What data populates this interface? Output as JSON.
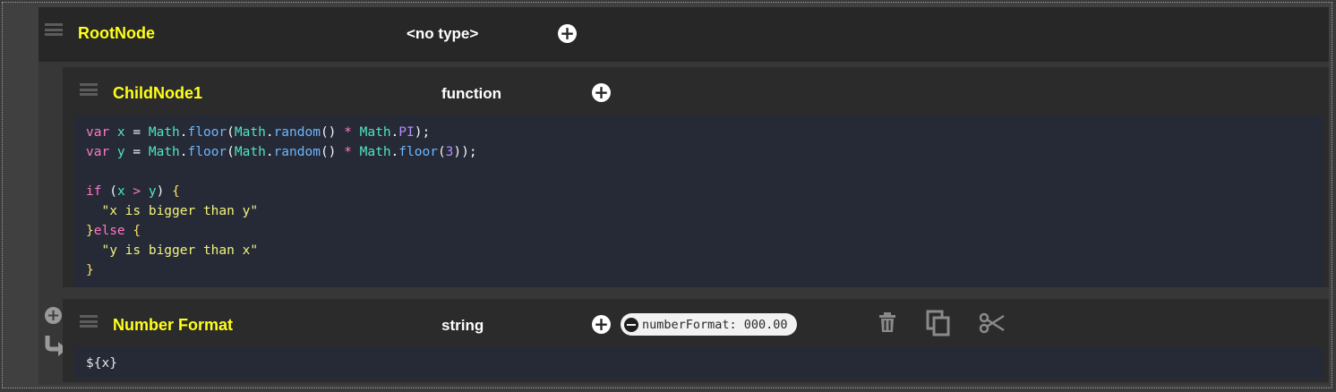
{
  "root": {
    "name": "RootNode",
    "type": "<no type>"
  },
  "child": {
    "name": "ChildNode1",
    "type": "function",
    "code_lines": [
      [
        [
          "kw",
          "var "
        ],
        [
          "var",
          "x"
        ],
        [
          "pl",
          " = "
        ],
        [
          "var",
          "Math"
        ],
        [
          "pl",
          "."
        ],
        [
          "fn",
          "floor"
        ],
        [
          "pl",
          "("
        ],
        [
          "var",
          "Math"
        ],
        [
          "pl",
          "."
        ],
        [
          "fn",
          "random"
        ],
        [
          "pl",
          "() "
        ],
        [
          "op",
          "*"
        ],
        [
          "pl",
          " "
        ],
        [
          "var",
          "Math"
        ],
        [
          "pl",
          "."
        ],
        [
          "num",
          "PI"
        ],
        [
          "pl",
          ");"
        ]
      ],
      [
        [
          "kw",
          "var "
        ],
        [
          "var",
          "y"
        ],
        [
          "pl",
          " = "
        ],
        [
          "var",
          "Math"
        ],
        [
          "pl",
          "."
        ],
        [
          "fn",
          "floor"
        ],
        [
          "pl",
          "("
        ],
        [
          "var",
          "Math"
        ],
        [
          "pl",
          "."
        ],
        [
          "fn",
          "random"
        ],
        [
          "pl",
          "() "
        ],
        [
          "op",
          "*"
        ],
        [
          "pl",
          " "
        ],
        [
          "var",
          "Math"
        ],
        [
          "pl",
          "."
        ],
        [
          "fn",
          "floor"
        ],
        [
          "pl",
          "("
        ],
        [
          "num",
          "3"
        ],
        [
          "pl",
          "));"
        ]
      ],
      [],
      [
        [
          "kw",
          "if "
        ],
        [
          "pl",
          "("
        ],
        [
          "var",
          "x"
        ],
        [
          "op",
          " > "
        ],
        [
          "var",
          "y"
        ],
        [
          "pl",
          ") "
        ],
        [
          "br",
          "{"
        ]
      ],
      [
        [
          "str",
          "  \"x is bigger than y\""
        ]
      ],
      [
        [
          "br",
          "}"
        ],
        [
          "kw",
          "else "
        ],
        [
          "br",
          "{"
        ]
      ],
      [
        [
          "str",
          "  \"y is bigger than x\""
        ]
      ],
      [
        [
          "br",
          "}"
        ]
      ]
    ]
  },
  "number_format": {
    "name": "Number Format",
    "type": "string",
    "tag": "numberFormat: 000.00",
    "code": "${x}"
  },
  "icons": {
    "drag": "drag-handle-icon",
    "add": "plus-circle-icon",
    "remove_tag": "minus-circle-icon",
    "delete": "trash-icon",
    "copy": "copy-icon",
    "cut": "scissors-icon",
    "move": "arrow-return-icon"
  }
}
